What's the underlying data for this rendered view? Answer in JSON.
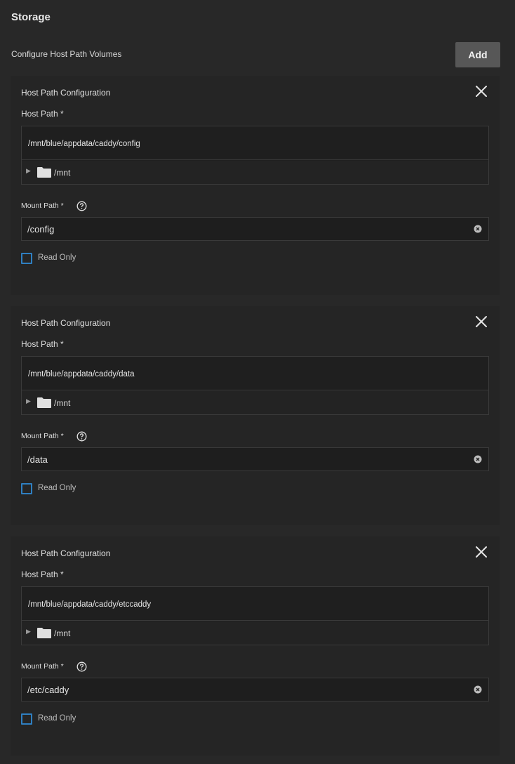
{
  "header": {
    "title": "Storage",
    "subtitle": "Configure Host Path Volumes",
    "add_label": "Add"
  },
  "colors": {
    "background": "#282828",
    "card": "#252525",
    "input": "#1e1e1e",
    "checkbox_border": "#2f7fc1",
    "add_button": "#575757"
  },
  "volumes": [
    {
      "title": "Host Path Configuration",
      "host_path_label": "Host Path *",
      "host_path_value": "/mnt/blue/appdata/caddy/config",
      "tree_root": "/mnt",
      "mount_path_label": "Mount Path *",
      "mount_path_value": "/config",
      "read_only_label": "Read Only"
    },
    {
      "title": "Host Path Configuration",
      "host_path_label": "Host Path *",
      "host_path_value": "/mnt/blue/appdata/caddy/data",
      "tree_root": "/mnt",
      "mount_path_label": "Mount Path *",
      "mount_path_value": "/data",
      "read_only_label": "Read Only"
    },
    {
      "title": "Host Path Configuration",
      "host_path_label": "Host Path *",
      "host_path_value": "/mnt/blue/appdata/caddy/etccaddy",
      "tree_root": "/mnt",
      "mount_path_label": "Mount Path *",
      "mount_path_value": "/etc/caddy",
      "read_only_label": "Read Only"
    }
  ],
  "icons": {
    "close": "close-icon",
    "folder": "folder-icon",
    "help": "help-circle-icon",
    "clear": "clear-circle-icon",
    "expand": "triangle-right-icon"
  }
}
